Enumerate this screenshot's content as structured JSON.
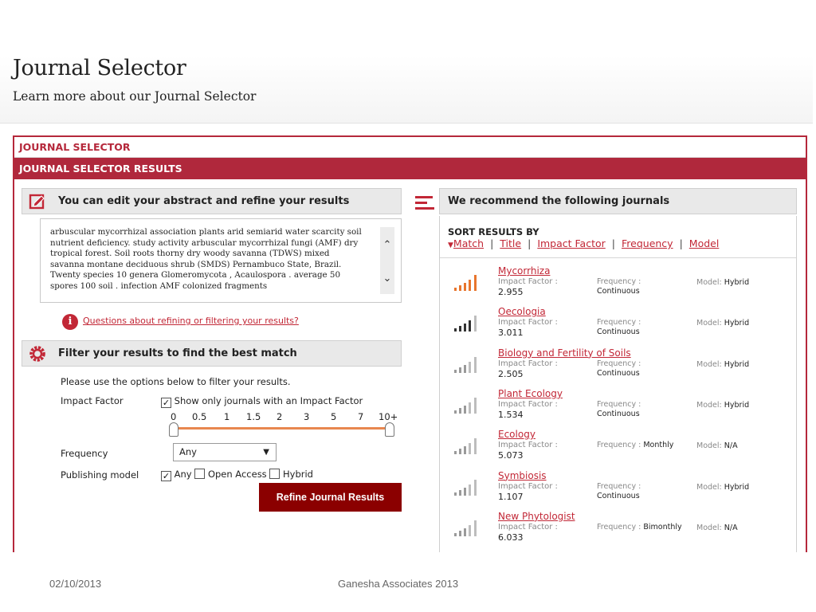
{
  "header": {
    "title": "Journal Selector",
    "subtitle": "Learn more about our Journal Selector"
  },
  "frame": {
    "title": "JOURNAL SELECTOR",
    "results_bar": "JOURNAL SELECTOR RESULTS"
  },
  "edit_panel": {
    "heading": "You can edit your abstract and refine your results",
    "icon": "edit-icon",
    "abstract": "arbuscular mycorrhizal association plants arid semiarid water scarcity soil nutrient deficiency. study activity arbuscular mycorrhizal fungi (AMF) dry tropical forest. Soil roots thorny dry woody savanna (TDWS) mixed savanna montane deciduous shrub (SMDS) Pernambuco State, Brazil. Twenty species 10 genera Glomeromycota , Acaulospora . average 50 spores 100 soil . infection AMF colonized fragments",
    "help_link": "Questions about refining or filtering your results?",
    "help_icon": "info-icon"
  },
  "filter_panel": {
    "heading": "Filter your results to find the best match",
    "icon": "gear-icon",
    "intro": "Please use the options below to filter your results.",
    "impact_factor_label": "Impact Factor",
    "impact_factor_checkbox": "Show only journals with an Impact Factor",
    "impact_factor_checked": true,
    "slider_ticks": [
      "0",
      "0.5",
      "1",
      "1.5",
      "2",
      "3",
      "5",
      "7",
      "10+"
    ],
    "slider_range": [
      "0",
      "10+"
    ],
    "frequency_label": "Frequency",
    "frequency_value": "Any",
    "publishing_label": "Publishing model",
    "publishing_options": [
      {
        "label": "Any",
        "checked": true
      },
      {
        "label": "Open Access",
        "checked": false
      },
      {
        "label": "Hybrid",
        "checked": false
      }
    ],
    "refine_button": "Refine Journal Results"
  },
  "results_panel": {
    "heading": "We recommend the following journals",
    "icon": "list-icon",
    "sort_title": "SORT RESULTS BY",
    "sort_options": [
      "Match",
      "Title",
      "Impact Factor",
      "Frequency",
      "Model"
    ],
    "sort_active": "Match",
    "impact_label": "Impact Factor :",
    "frequency_label": "Frequency :",
    "model_label": "Model:",
    "journals": [
      {
        "name": "Mycorrhiza",
        "impact": "2.955",
        "frequency": "Continuous",
        "model": "Hybrid",
        "match_bars": 5
      },
      {
        "name": "Oecologia",
        "impact": "3.011",
        "frequency": "Continuous",
        "model": "Hybrid",
        "match_bars": 4
      },
      {
        "name": "Biology and Fertility of Soils",
        "impact": "2.505",
        "frequency": "Continuous",
        "model": "Hybrid",
        "match_bars": 0
      },
      {
        "name": "Plant Ecology",
        "impact": "1.534",
        "frequency": "Continuous",
        "model": "Hybrid",
        "match_bars": 0
      },
      {
        "name": "Ecology",
        "impact": "5.073",
        "frequency": "Monthly",
        "model": "N/A",
        "match_bars": 0
      },
      {
        "name": "Symbiosis",
        "impact": "1.107",
        "frequency": "Continuous",
        "model": "Hybrid",
        "match_bars": 0
      },
      {
        "name": "New Phytologist",
        "impact": "6.033",
        "frequency": "Bimonthly",
        "model": "N/A",
        "match_bars": 0
      }
    ]
  },
  "footer": {
    "date": "02/10/2013",
    "company": "Ganesha Associates 2013"
  },
  "colors": {
    "accent": "#b0283c",
    "link": "#c22736",
    "button": "#8b0000",
    "bars_active_strong": "#e8752d",
    "bars_active_dark": "#333333",
    "bars_inactive": "#bdbdbd"
  }
}
